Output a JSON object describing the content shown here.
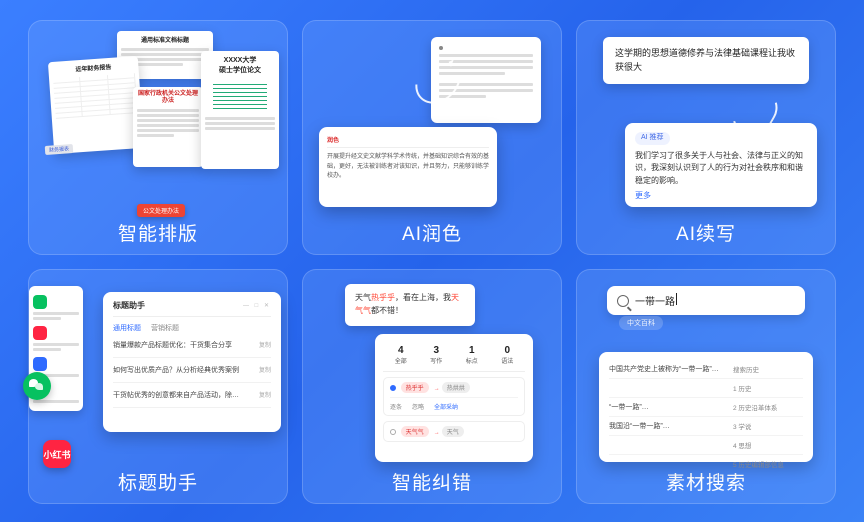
{
  "cards": {
    "c1": {
      "label": "智能排版",
      "doc1_title": "通用标准文档标题",
      "doc2_title": "近年财务报告",
      "doc3_title": "国家行政机关公文处理办法",
      "doc4_title": "XXXX大学\n硕士学位论文",
      "tag_left": "财务报表",
      "red_strip": "公文处理办法"
    },
    "c2": {
      "label": "AI润色",
      "big_tab": "润色",
      "big_body": "开展提升经文史文献学科学术传统，并基础知识综合有效的基础，更好，无法被训练者对该知识，并且努力，只能够训练学校办。"
    },
    "c3": {
      "label": "AI续写",
      "prompt": "这学期的思想道德修养与法律基础课程让我收获很大",
      "badge": "AI 推荐",
      "completion": "我们学习了很多关于人与社会、法律与正义的知识，我深刻认识到了人的行为对社会秩序和和谐稳定的影响。",
      "more": "更多"
    },
    "c4": {
      "label": "标题助手",
      "panel_title": "标题助手",
      "tab1": "通用标题",
      "tab2": "营销标题",
      "items": [
        "销量爆款产品标题优化：干货集合分享",
        "如何写出优质产品？从分析经典优秀案例",
        "干货帖优秀的创意都来自产品活动，除…"
      ],
      "copy": "复制",
      "xhs": "小红书"
    },
    "c5": {
      "label": "智能纠错",
      "sentence_pre": "天气",
      "wrong1": "热乎乎",
      "sentence_mid": "，看在上海，我",
      "wrong2": "天气气",
      "sentence_end": "都不错！",
      "stats": [
        {
          "n": "4",
          "t": "全部"
        },
        {
          "n": "3",
          "t": "写作"
        },
        {
          "n": "1",
          "t": "标点"
        },
        {
          "n": "0",
          "t": "语法"
        }
      ],
      "rule1_from": "热乎乎",
      "rule1_to": "热烘烘",
      "rule2_from": "天气气",
      "rule2_to": "天气",
      "opt1": "逐条",
      "opt2": "忽略",
      "opt3": "全部采纳"
    },
    "c6": {
      "label": "素材搜索",
      "query": "一带一路",
      "hint": "中文百科",
      "rows": [
        {
          "l": "中国共产党史上被称为“一带一路”…",
          "r": "搜索历史"
        },
        {
          "l": "",
          "r": "1 历史"
        },
        {
          "l": "“一带一路”…",
          "r": "2 历史沿革体系"
        },
        {
          "l": "我国沿“一带一路”…",
          "r": "3 学说"
        },
        {
          "l": "",
          "r": "4 思想"
        },
        {
          "l": "",
          "r": "5 历史编辑部信息"
        }
      ]
    }
  }
}
